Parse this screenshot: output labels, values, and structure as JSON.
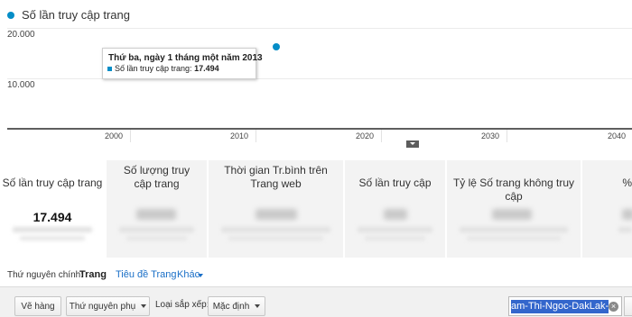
{
  "chart": {
    "legend_label": "Số lần truy cập trang",
    "tooltip": {
      "title": "Thứ ba, ngày 1 tháng một năm 2013",
      "row_label": "Số lần truy cập trang:",
      "row_value": "17.494"
    }
  },
  "chart_data": {
    "type": "scatter",
    "title": "",
    "xlabel": "",
    "ylabel": "",
    "x_ticks": [
      "2000",
      "2010",
      "2020",
      "2030",
      "2040"
    ],
    "y_ticks": [
      "20.000",
      "10.000"
    ],
    "ylim": [
      0,
      20000
    ],
    "series": [
      {
        "name": "Số lần truy cập trang",
        "x": [
          2013.0
        ],
        "y": [
          17494
        ]
      }
    ],
    "colors": {
      "series": "#058dc7"
    },
    "grid": true,
    "legend": "top-left"
  },
  "metrics": [
    {
      "label": "Số lần truy cập trang",
      "value": "17.494",
      "selected": true
    },
    {
      "label": "Số lượng truy cập trang",
      "value": "",
      "selected": false
    },
    {
      "label": "Thời gian Tr.bình trên Trang web",
      "value": "",
      "selected": false
    },
    {
      "label": "Số lần truy cập",
      "value": "",
      "selected": false
    },
    {
      "label": "Tỷ lệ Số trang không truy cập",
      "value": "",
      "selected": false
    },
    {
      "label": "%",
      "value": "",
      "selected": false
    }
  ],
  "dimension": {
    "label": "Thứ nguyên chính:",
    "active": "Trang",
    "option_1": "Tiêu đề Trang",
    "option_2": "Khác"
  },
  "toolbar": {
    "plot_rows": "Vẽ hàng",
    "secondary_dimension": "Thứ nguyên phụ",
    "sort_label": "Loại sắp xếp:",
    "sort_value": "Mặc định",
    "search_value": "am-Thi-Ngoc-DakLak-D"
  }
}
